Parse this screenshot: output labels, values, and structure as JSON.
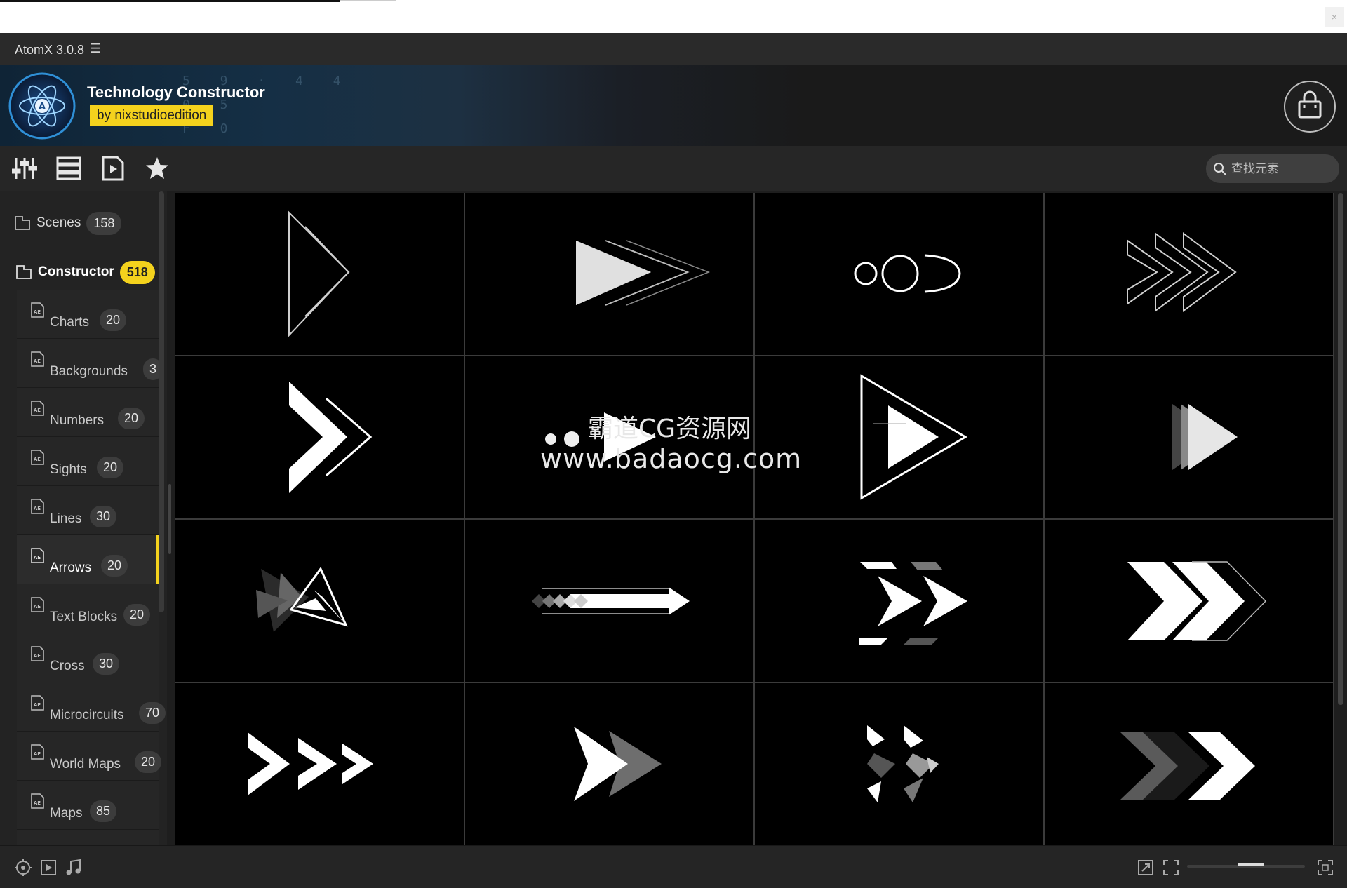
{
  "window": {
    "close_label": "×"
  },
  "app": {
    "title": "AtomX 3.0.8",
    "menu_icon": "hamburger-menu-icon"
  },
  "banner": {
    "pack_title": "Technology Constructor",
    "author": "by nixstudioedition"
  },
  "toolbar": {
    "icons": [
      "sliders-icon",
      "list-icon",
      "video-file-icon",
      "star-icon"
    ]
  },
  "search": {
    "placeholder": "查找元素"
  },
  "sidebar": {
    "scenes": {
      "label": "Scenes",
      "count": "158"
    },
    "constructor": {
      "label": "Constructor",
      "count": "518"
    },
    "categories": [
      {
        "label": "Charts",
        "count": "20"
      },
      {
        "label": "Backgrounds",
        "count": "3"
      },
      {
        "label": "Numbers",
        "count": "20"
      },
      {
        "label": "Sights",
        "count": "20"
      },
      {
        "label": "Lines",
        "count": "30"
      },
      {
        "label": "Arrows",
        "count": "20",
        "active": true
      },
      {
        "label": "Text Blocks",
        "count": "20"
      },
      {
        "label": "Cross",
        "count": "30"
      },
      {
        "label": "Microcircuits",
        "count": "70"
      },
      {
        "label": "World Maps",
        "count": "20"
      },
      {
        "label": "Maps",
        "count": "85"
      }
    ]
  },
  "grid": {
    "tiles": [
      "outline-triangle-arrow",
      "double-chevron-arrow",
      "circles-arrow",
      "triple-outline-chevron",
      "bold-chevron-arrow",
      "play-circle-arrow",
      "play-triangle-outline",
      "faded-play-arrow",
      "triangle-shards-arrow",
      "pixel-trail-arrow",
      "striped-double-chevron",
      "double-chevron-outline",
      "triple-small-chevron",
      "chevron-shadow-arrow",
      "fragmented-chevron",
      "gradient-double-chevron"
    ]
  },
  "watermark": {
    "line1": "霸道CG资源网",
    "line2": "www.badaocg.com"
  },
  "bottombar": {
    "left_icons": [
      "location-icon",
      "play-frame-icon",
      "music-note-icon"
    ],
    "right_icons": [
      "expand-icon",
      "fullscreen-icon",
      "grid-resize-icon"
    ],
    "zoom": 0.55
  },
  "colors": {
    "accent": "#f4d21d",
    "panel": "#232323",
    "tile_bg": "#000000"
  }
}
